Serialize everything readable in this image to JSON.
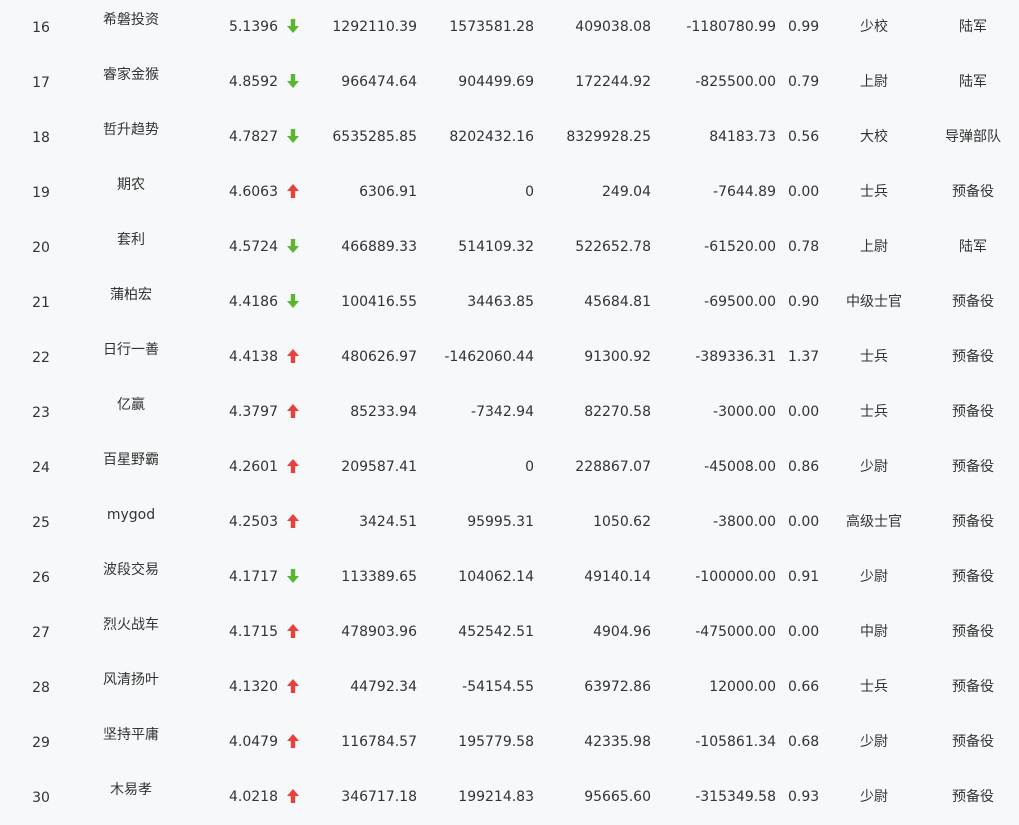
{
  "colors": {
    "up": "#e8413c",
    "down": "#5cb531",
    "text": "#333333",
    "background": "#f6f8fa"
  },
  "rows": [
    {
      "rank": "16",
      "name": "希磐投资",
      "score": "5.1396",
      "trend": "down",
      "v1": "1292110.39",
      "v2": "1573581.28",
      "v3": "409038.08",
      "v4": "-1180780.99",
      "v5": "0.99",
      "rank_title": "少校",
      "branch": "陆军"
    },
    {
      "rank": "17",
      "name": "睿家金猴",
      "score": "4.8592",
      "trend": "down",
      "v1": "966474.64",
      "v2": "904499.69",
      "v3": "172244.92",
      "v4": "-825500.00",
      "v5": "0.79",
      "rank_title": "上尉",
      "branch": "陆军"
    },
    {
      "rank": "18",
      "name": "哲升趋势",
      "score": "4.7827",
      "trend": "down",
      "v1": "6535285.85",
      "v2": "8202432.16",
      "v3": "8329928.25",
      "v4": "84183.73",
      "v5": "0.56",
      "rank_title": "大校",
      "branch": "导弹部队"
    },
    {
      "rank": "19",
      "name": "期农",
      "score": "4.6063",
      "trend": "up",
      "v1": "6306.91",
      "v2": "0",
      "v3": "249.04",
      "v4": "-7644.89",
      "v5": "0.00",
      "rank_title": "士兵",
      "branch": "预备役"
    },
    {
      "rank": "20",
      "name": "套利",
      "score": "4.5724",
      "trend": "down",
      "v1": "466889.33",
      "v2": "514109.32",
      "v3": "522652.78",
      "v4": "-61520.00",
      "v5": "0.78",
      "rank_title": "上尉",
      "branch": "陆军"
    },
    {
      "rank": "21",
      "name": "蒲柏宏",
      "score": "4.4186",
      "trend": "down",
      "v1": "100416.55",
      "v2": "34463.85",
      "v3": "45684.81",
      "v4": "-69500.00",
      "v5": "0.90",
      "rank_title": "中级士官",
      "branch": "预备役"
    },
    {
      "rank": "22",
      "name": "日行一善",
      "score": "4.4138",
      "trend": "up",
      "v1": "480626.97",
      "v2": "-1462060.44",
      "v3": "91300.92",
      "v4": "-389336.31",
      "v5": "1.37",
      "rank_title": "士兵",
      "branch": "预备役"
    },
    {
      "rank": "23",
      "name": "亿赢",
      "score": "4.3797",
      "trend": "up",
      "v1": "85233.94",
      "v2": "-7342.94",
      "v3": "82270.58",
      "v4": "-3000.00",
      "v5": "0.00",
      "rank_title": "士兵",
      "branch": "预备役"
    },
    {
      "rank": "24",
      "name": "百星野霸",
      "score": "4.2601",
      "trend": "up",
      "v1": "209587.41",
      "v2": "0",
      "v3": "228867.07",
      "v4": "-45008.00",
      "v5": "0.86",
      "rank_title": "少尉",
      "branch": "预备役"
    },
    {
      "rank": "25",
      "name": "mygod",
      "score": "4.2503",
      "trend": "up",
      "v1": "3424.51",
      "v2": "95995.31",
      "v3": "1050.62",
      "v4": "-3800.00",
      "v5": "0.00",
      "rank_title": "高级士官",
      "branch": "预备役"
    },
    {
      "rank": "26",
      "name": "波段交易",
      "score": "4.1717",
      "trend": "down",
      "v1": "113389.65",
      "v2": "104062.14",
      "v3": "49140.14",
      "v4": "-100000.00",
      "v5": "0.91",
      "rank_title": "少尉",
      "branch": "预备役"
    },
    {
      "rank": "27",
      "name": "烈火战车",
      "score": "4.1715",
      "trend": "up",
      "v1": "478903.96",
      "v2": "452542.51",
      "v3": "4904.96",
      "v4": "-475000.00",
      "v5": "0.00",
      "rank_title": "中尉",
      "branch": "预备役"
    },
    {
      "rank": "28",
      "name": "风清扬叶",
      "score": "4.1320",
      "trend": "up",
      "v1": "44792.34",
      "v2": "-54154.55",
      "v3": "63972.86",
      "v4": "12000.00",
      "v5": "0.66",
      "rank_title": "士兵",
      "branch": "预备役"
    },
    {
      "rank": "29",
      "name": "坚持平庸",
      "score": "4.0479",
      "trend": "up",
      "v1": "116784.57",
      "v2": "195779.58",
      "v3": "42335.98",
      "v4": "-105861.34",
      "v5": "0.68",
      "rank_title": "少尉",
      "branch": "预备役"
    },
    {
      "rank": "30",
      "name": "木易孝",
      "score": "4.0218",
      "trend": "up",
      "v1": "346717.18",
      "v2": "199214.83",
      "v3": "95665.60",
      "v4": "-315349.58",
      "v5": "0.93",
      "rank_title": "少尉",
      "branch": "预备役"
    }
  ]
}
